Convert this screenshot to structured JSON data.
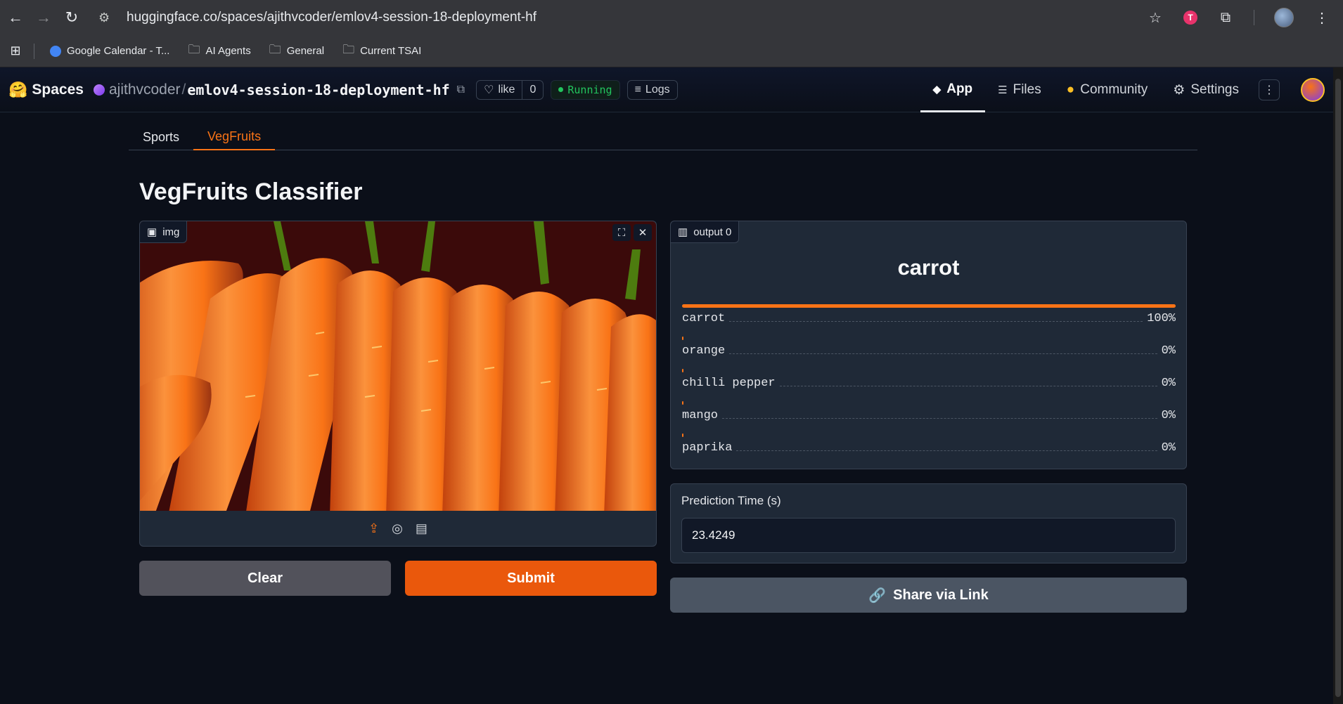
{
  "browser": {
    "url": "huggingface.co/spaces/ajithvcoder/emlov4-session-18-deployment-hf",
    "bookmarks": [
      {
        "label": "Google Calendar - T...",
        "icon": "google-calendar-icon"
      },
      {
        "label": "AI Agents",
        "icon": "folder-icon"
      },
      {
        "label": "General",
        "icon": "folder-icon"
      },
      {
        "label": "Current TSAI",
        "icon": "folder-icon"
      }
    ],
    "extension_badge": "T"
  },
  "hf_header": {
    "spaces_label": "Spaces",
    "owner": "ajithvcoder",
    "slash": "/",
    "repo": "emlov4-session-18-deployment-hf",
    "like_label": "like",
    "like_count": "0",
    "status": "Running",
    "logs_label": "Logs",
    "nav": {
      "app": "App",
      "files": "Files",
      "community": "Community",
      "settings": "Settings"
    }
  },
  "app": {
    "tabs": [
      "Sports",
      "VegFruits"
    ],
    "active_tab": "VegFruits",
    "title": "VegFruits Classifier",
    "image_label": "img",
    "output_label": "output 0",
    "prediction": "carrot",
    "confidences": [
      {
        "label": "carrot",
        "value": "100%",
        "fraction": 1.0
      },
      {
        "label": "orange",
        "value": "0%",
        "fraction": 0.0
      },
      {
        "label": "chilli pepper",
        "value": "0%",
        "fraction": 0.0
      },
      {
        "label": "mango",
        "value": "0%",
        "fraction": 0.0
      },
      {
        "label": "paprika",
        "value": "0%",
        "fraction": 0.0
      }
    ],
    "time_label": "Prediction Time (s)",
    "time_value": "23.4249",
    "clear_label": "Clear",
    "submit_label": "Submit",
    "share_label": "Share via Link"
  },
  "colors": {
    "accent": "#f97316",
    "submit": "#ea580c",
    "running": "#22c55e",
    "bg": "#0b0f19"
  }
}
